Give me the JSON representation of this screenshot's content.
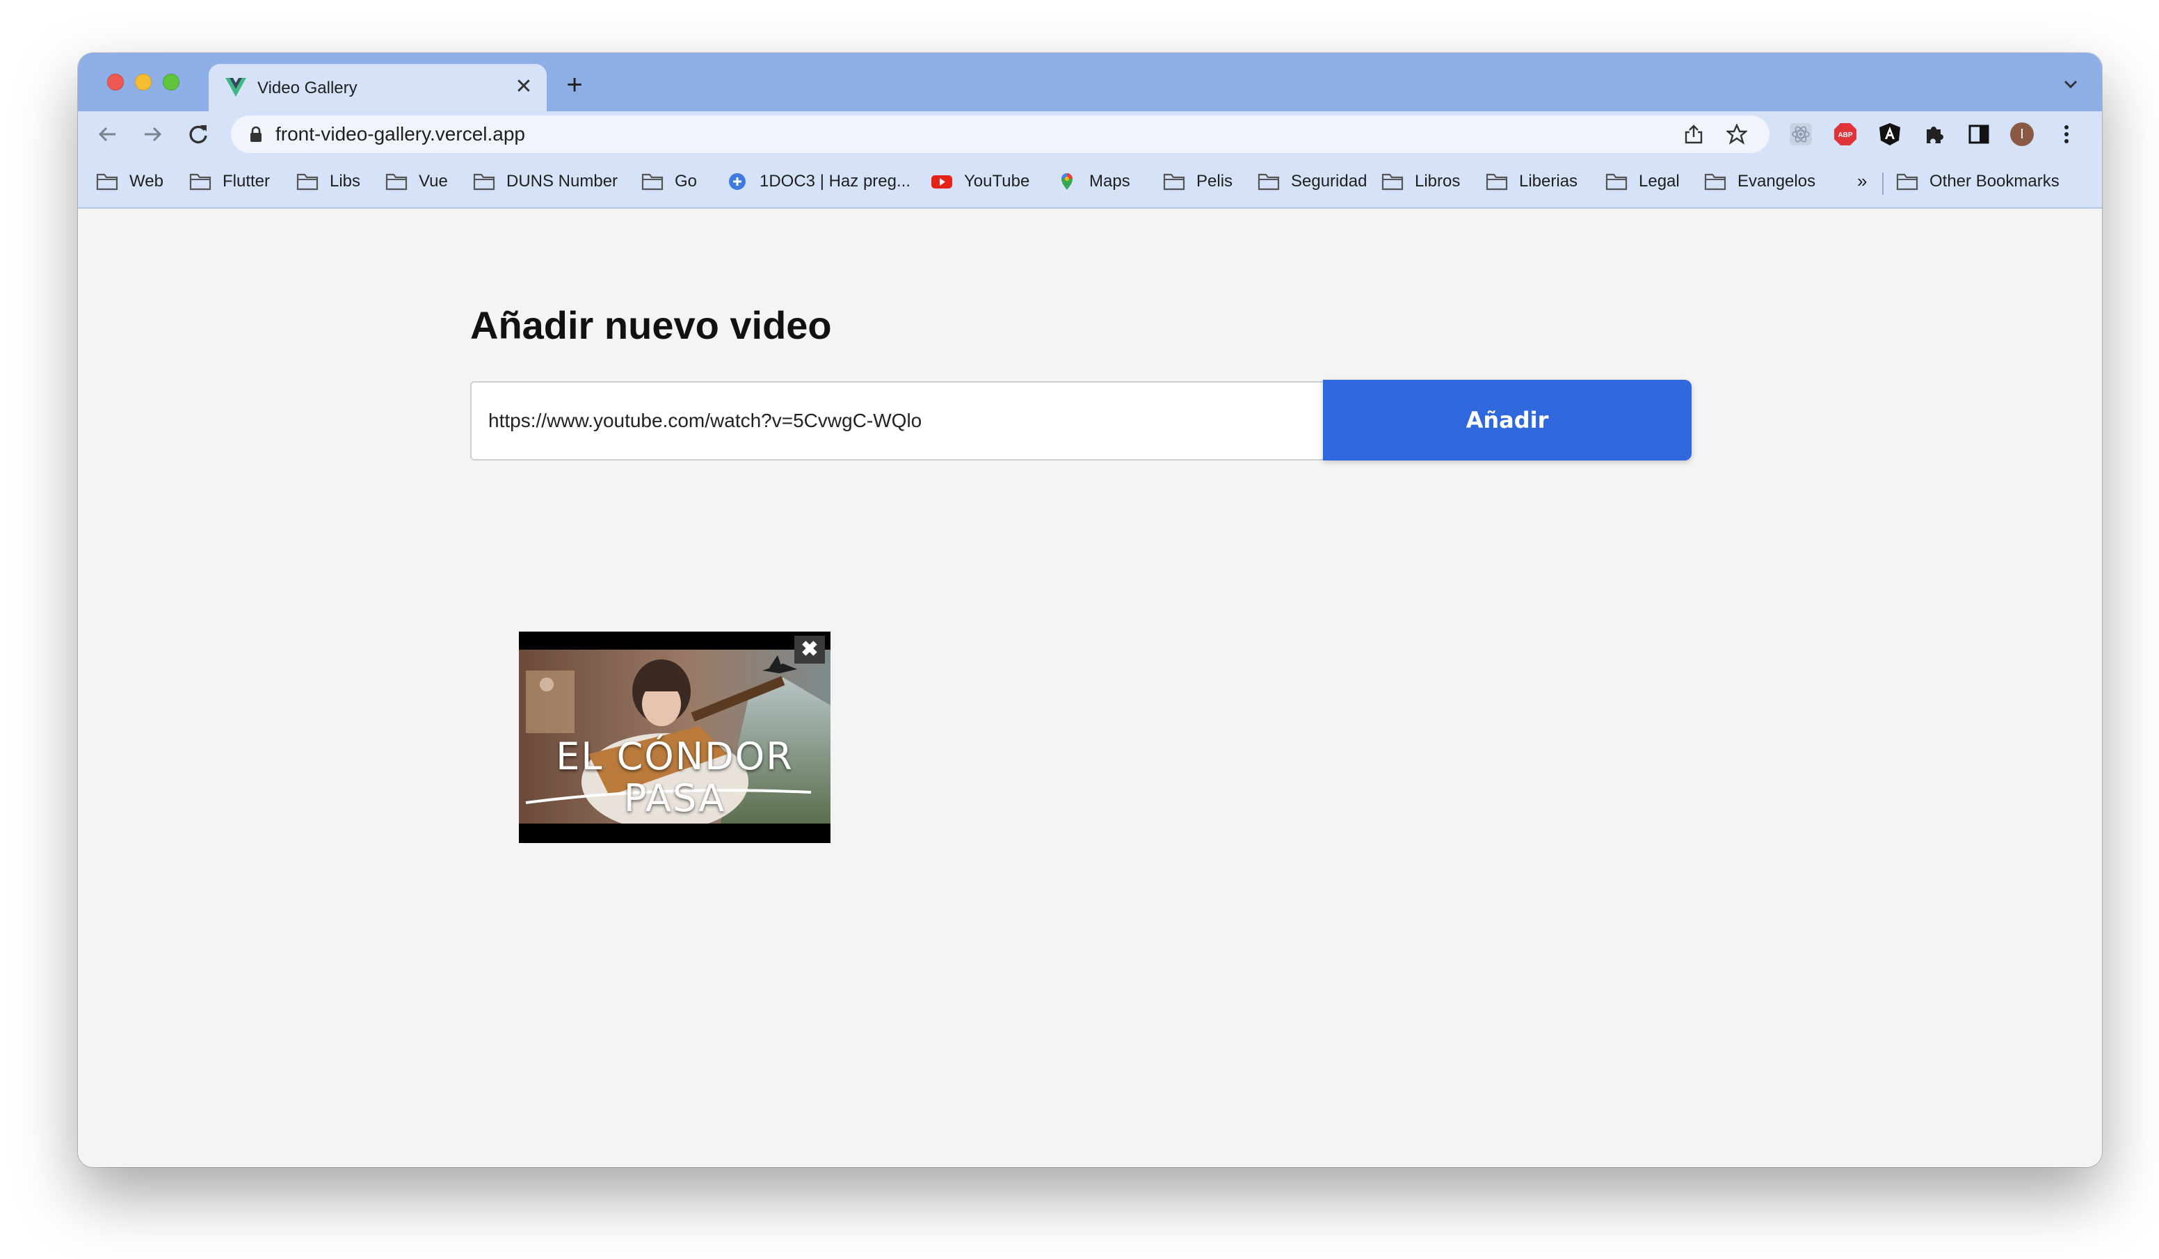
{
  "browser": {
    "tab": {
      "title": "Video Gallery",
      "close_glyph": "✕"
    },
    "new_tab_glyph": "+",
    "address": {
      "url": "front-video-gallery.vercel.app"
    },
    "bookmarks": [
      {
        "label": "Web",
        "icon": "folder-icon"
      },
      {
        "label": "Flutter",
        "icon": "folder-icon"
      },
      {
        "label": "Libs",
        "icon": "folder-icon"
      },
      {
        "label": "Vue",
        "icon": "folder-icon"
      },
      {
        "label": "DUNS Number",
        "icon": "folder-icon"
      },
      {
        "label": "Go",
        "icon": "folder-icon"
      },
      {
        "label": "1DOC3 | Haz preg...",
        "icon": "plus-circle-icon"
      },
      {
        "label": "YouTube",
        "icon": "youtube-icon"
      },
      {
        "label": "Maps",
        "icon": "maps-pin-icon"
      },
      {
        "label": "Pelis",
        "icon": "folder-icon"
      },
      {
        "label": "Seguridad",
        "icon": "folder-icon"
      },
      {
        "label": "Libros",
        "icon": "folder-icon"
      },
      {
        "label": "Liberias",
        "icon": "folder-icon"
      },
      {
        "label": "Legal",
        "icon": "folder-icon"
      },
      {
        "label": "Evangelos",
        "icon": "folder-icon"
      }
    ],
    "bookmarks_overflow": "»",
    "other_bookmarks": "Other Bookmarks",
    "colors": {
      "tabstrip": "#8eaee6",
      "toolbar": "#d6e2f7"
    }
  },
  "page": {
    "heading": "Añadir nuevo video",
    "input": {
      "value": "https://www.youtube.com/watch?v=5CvwgC-WQlo"
    },
    "add_button": "Añadir",
    "videos": [
      {
        "thumbnail_text": "EL CÓNDOR PASA",
        "remove_glyph": "✖"
      }
    ],
    "colors": {
      "accent": "#2f67dc",
      "background": "#f4f4f4"
    }
  }
}
